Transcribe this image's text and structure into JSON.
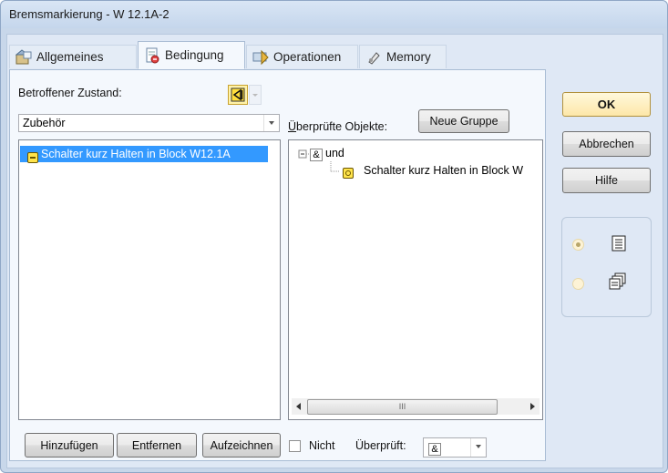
{
  "window": {
    "title": "Bremsmarkierung - W 12.1A-2"
  },
  "tabs": [
    {
      "label": "Allgemeines",
      "icon": "properties-icon",
      "active": false
    },
    {
      "label": "Bedingung",
      "icon": "condition-icon",
      "active": true
    },
    {
      "label": "Operationen",
      "icon": "operations-icon",
      "active": false
    },
    {
      "label": "Memory",
      "icon": "memory-icon",
      "active": false
    }
  ],
  "left": {
    "state_label": "Betroffener Zustand:",
    "category_value": "Zubehör",
    "items": [
      {
        "label": "Schalter kurz Halten in Block W12.1A",
        "selected": true
      }
    ]
  },
  "right": {
    "checked_label": "Überprüfte Objekte:",
    "new_group_button": "Neue Gruppe",
    "tree": {
      "root_op": "&",
      "root_label": "und",
      "child_label": "Schalter kurz Halten in Block W"
    },
    "scroll_thumb_glyph": "III"
  },
  "bottom": {
    "add_button": "Hinzufügen",
    "remove_button": "Entfernen",
    "record_button": "Aufzeichnen",
    "not_label": "Nicht",
    "not_checked": false,
    "checked_by_label": "Überprüft:",
    "checked_by_value": "&"
  },
  "dialog_buttons": {
    "ok": "OK",
    "cancel": "Abbrechen",
    "help": "Hilfe"
  },
  "view_mode": {
    "selected": "list",
    "options": [
      {
        "icon": "list-view-icon"
      },
      {
        "icon": "copy-view-icon"
      }
    ]
  },
  "colors": {
    "selection": "#3399ff",
    "ok_button": "#fde7a8",
    "accent_yellow": "#ffe44c"
  }
}
